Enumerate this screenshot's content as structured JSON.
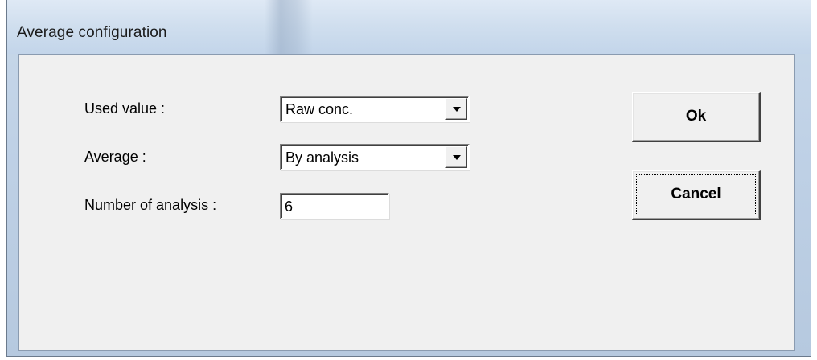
{
  "window": {
    "title": "Average configuration"
  },
  "form": {
    "used_value": {
      "label": "Used value :",
      "selected": "Raw conc."
    },
    "average": {
      "label": "Average :",
      "selected": "By analysis"
    },
    "number_of_analysis": {
      "label": "Number of analysis :",
      "value": "6"
    }
  },
  "buttons": {
    "ok": "Ok",
    "cancel": "Cancel"
  },
  "icons": {
    "dropdown": "chevron-down-icon"
  }
}
